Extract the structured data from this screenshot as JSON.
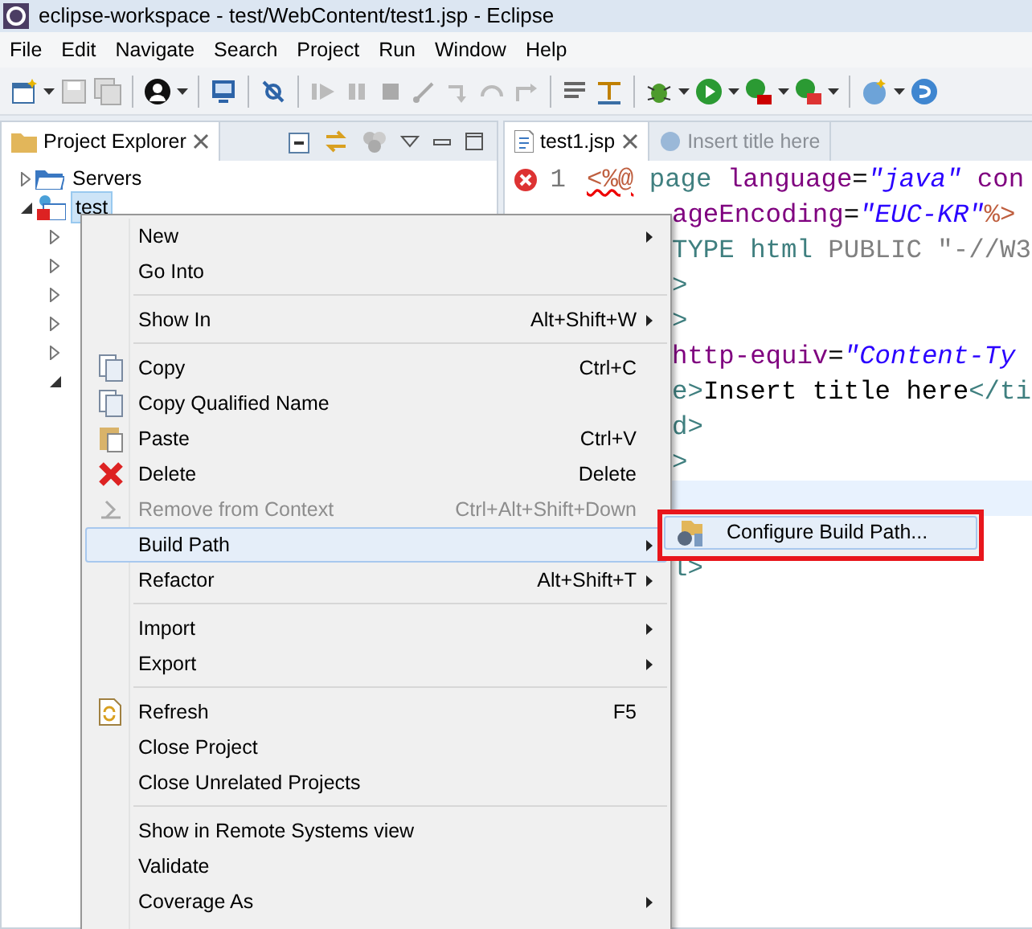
{
  "window": {
    "title": "eclipse-workspace - test/WebContent/test1.jsp - Eclipse"
  },
  "menu_bar": [
    "File",
    "Edit",
    "Navigate",
    "Search",
    "Project",
    "Run",
    "Window",
    "Help"
  ],
  "project_explorer": {
    "title": "Project Explorer",
    "tree": [
      {
        "label": "Servers",
        "expanded": false,
        "selected": false
      },
      {
        "label": "test",
        "expanded": true,
        "selected": true,
        "children": [
          {
            "expanded": false
          },
          {
            "expanded": false
          },
          {
            "expanded": false
          },
          {
            "expanded": false
          },
          {
            "expanded": false
          },
          {
            "expanded": true
          }
        ]
      }
    ]
  },
  "editor": {
    "tabs": [
      {
        "label": "test1.jsp",
        "selected": true
      },
      {
        "label": "Insert title here",
        "selected": false
      }
    ],
    "lines": [
      {
        "number": "1",
        "error": true,
        "current": false,
        "segments": [
          {
            "kind": "directive",
            "text": "<%@"
          },
          {
            "kind": "tag",
            "text": " page"
          },
          {
            "kind": "attr",
            "text": " language"
          },
          {
            "kind": "plain",
            "text": "="
          },
          {
            "kind": "string",
            "text": "\"java\""
          },
          {
            "kind": "attr",
            "text": " con"
          }
        ]
      },
      {
        "current": false,
        "segments": [
          {
            "kind": "attr",
            "text": "ageEncoding"
          },
          {
            "kind": "plain",
            "text": "="
          },
          {
            "kind": "string",
            "text": "\"EUC-KR\""
          },
          {
            "kind": "directive",
            "text": "%>"
          }
        ]
      },
      {
        "current": false,
        "segments": [
          {
            "kind": "tag",
            "text": "TYPE html"
          },
          {
            "kind": "doctype",
            "text": " PUBLIC \"-//W3"
          }
        ]
      },
      {
        "current": false,
        "segments": [
          {
            "kind": "tag",
            "text": ">"
          }
        ]
      },
      {
        "current": false,
        "segments": [
          {
            "kind": "tag",
            "text": ">"
          }
        ]
      },
      {
        "current": false,
        "segments": [
          {
            "kind": "attr",
            "text": "http-equiv"
          },
          {
            "kind": "plain",
            "text": "="
          },
          {
            "kind": "string",
            "text": "\"Content-Ty"
          }
        ]
      },
      {
        "current": false,
        "segments": [
          {
            "kind": "tag",
            "text": "e>"
          },
          {
            "kind": "plain",
            "text": "Insert title here"
          },
          {
            "kind": "tag",
            "text": "</ti"
          }
        ]
      },
      {
        "current": false,
        "segments": [
          {
            "kind": "tag",
            "text": "d>"
          }
        ]
      },
      {
        "current": false,
        "segments": [
          {
            "kind": "tag",
            "text": ">"
          }
        ]
      },
      {
        "current": true
      },
      {
        "current": false
      },
      {
        "current": false,
        "segments": [
          {
            "kind": "tag",
            "text": "l>"
          }
        ]
      }
    ]
  },
  "context_menu": {
    "items": [
      {
        "kind": "item",
        "label": "New",
        "submenu": true,
        "disabled": false,
        "selected": false
      },
      {
        "kind": "item",
        "label": "Go Into",
        "submenu": false,
        "disabled": false,
        "selected": false
      },
      {
        "kind": "separator"
      },
      {
        "kind": "item",
        "label": "Show In",
        "shortcut": "Alt+Shift+W",
        "submenu": true,
        "disabled": false,
        "selected": false
      },
      {
        "kind": "separator"
      },
      {
        "kind": "item",
        "label": "Copy",
        "shortcut": "Ctrl+C",
        "submenu": false,
        "disabled": false,
        "selected": false
      },
      {
        "kind": "item",
        "label": "Copy Qualified Name",
        "submenu": false,
        "disabled": false,
        "selected": false
      },
      {
        "kind": "item",
        "label": "Paste",
        "shortcut": "Ctrl+V",
        "submenu": false,
        "disabled": false,
        "selected": false
      },
      {
        "kind": "item",
        "label": "Delete",
        "shortcut": "Delete",
        "submenu": false,
        "disabled": false,
        "selected": false
      },
      {
        "kind": "item",
        "label": "Remove from Context",
        "shortcut": "Ctrl+Alt+Shift+Down",
        "submenu": false,
        "disabled": true,
        "selected": false
      },
      {
        "kind": "item",
        "label": "Build Path",
        "submenu": true,
        "disabled": false,
        "selected": true
      },
      {
        "kind": "item",
        "label": "Refactor",
        "shortcut": "Alt+Shift+T",
        "submenu": true,
        "disabled": false,
        "selected": false
      },
      {
        "kind": "separator"
      },
      {
        "kind": "item",
        "label": "Import",
        "submenu": true,
        "disabled": false,
        "selected": false
      },
      {
        "kind": "item",
        "label": "Export",
        "submenu": true,
        "disabled": false,
        "selected": false
      },
      {
        "kind": "separator"
      },
      {
        "kind": "item",
        "label": "Refresh",
        "shortcut": "F5",
        "submenu": false,
        "disabled": false,
        "selected": false
      },
      {
        "kind": "item",
        "label": "Close Project",
        "submenu": false,
        "disabled": false,
        "selected": false
      },
      {
        "kind": "item",
        "label": "Close Unrelated Projects",
        "submenu": false,
        "disabled": false,
        "selected": false
      },
      {
        "kind": "separator"
      },
      {
        "kind": "item",
        "label": "Show in Remote Systems view",
        "submenu": false,
        "disabled": false,
        "selected": false
      },
      {
        "kind": "item",
        "label": "Validate",
        "submenu": false,
        "disabled": false,
        "selected": false
      },
      {
        "kind": "item",
        "label": "Coverage As",
        "submenu": true,
        "disabled": false,
        "selected": false
      }
    ]
  },
  "submenu": {
    "highlighted": true,
    "items": [
      {
        "label": "Configure Build Path...",
        "selected": true
      }
    ]
  }
}
